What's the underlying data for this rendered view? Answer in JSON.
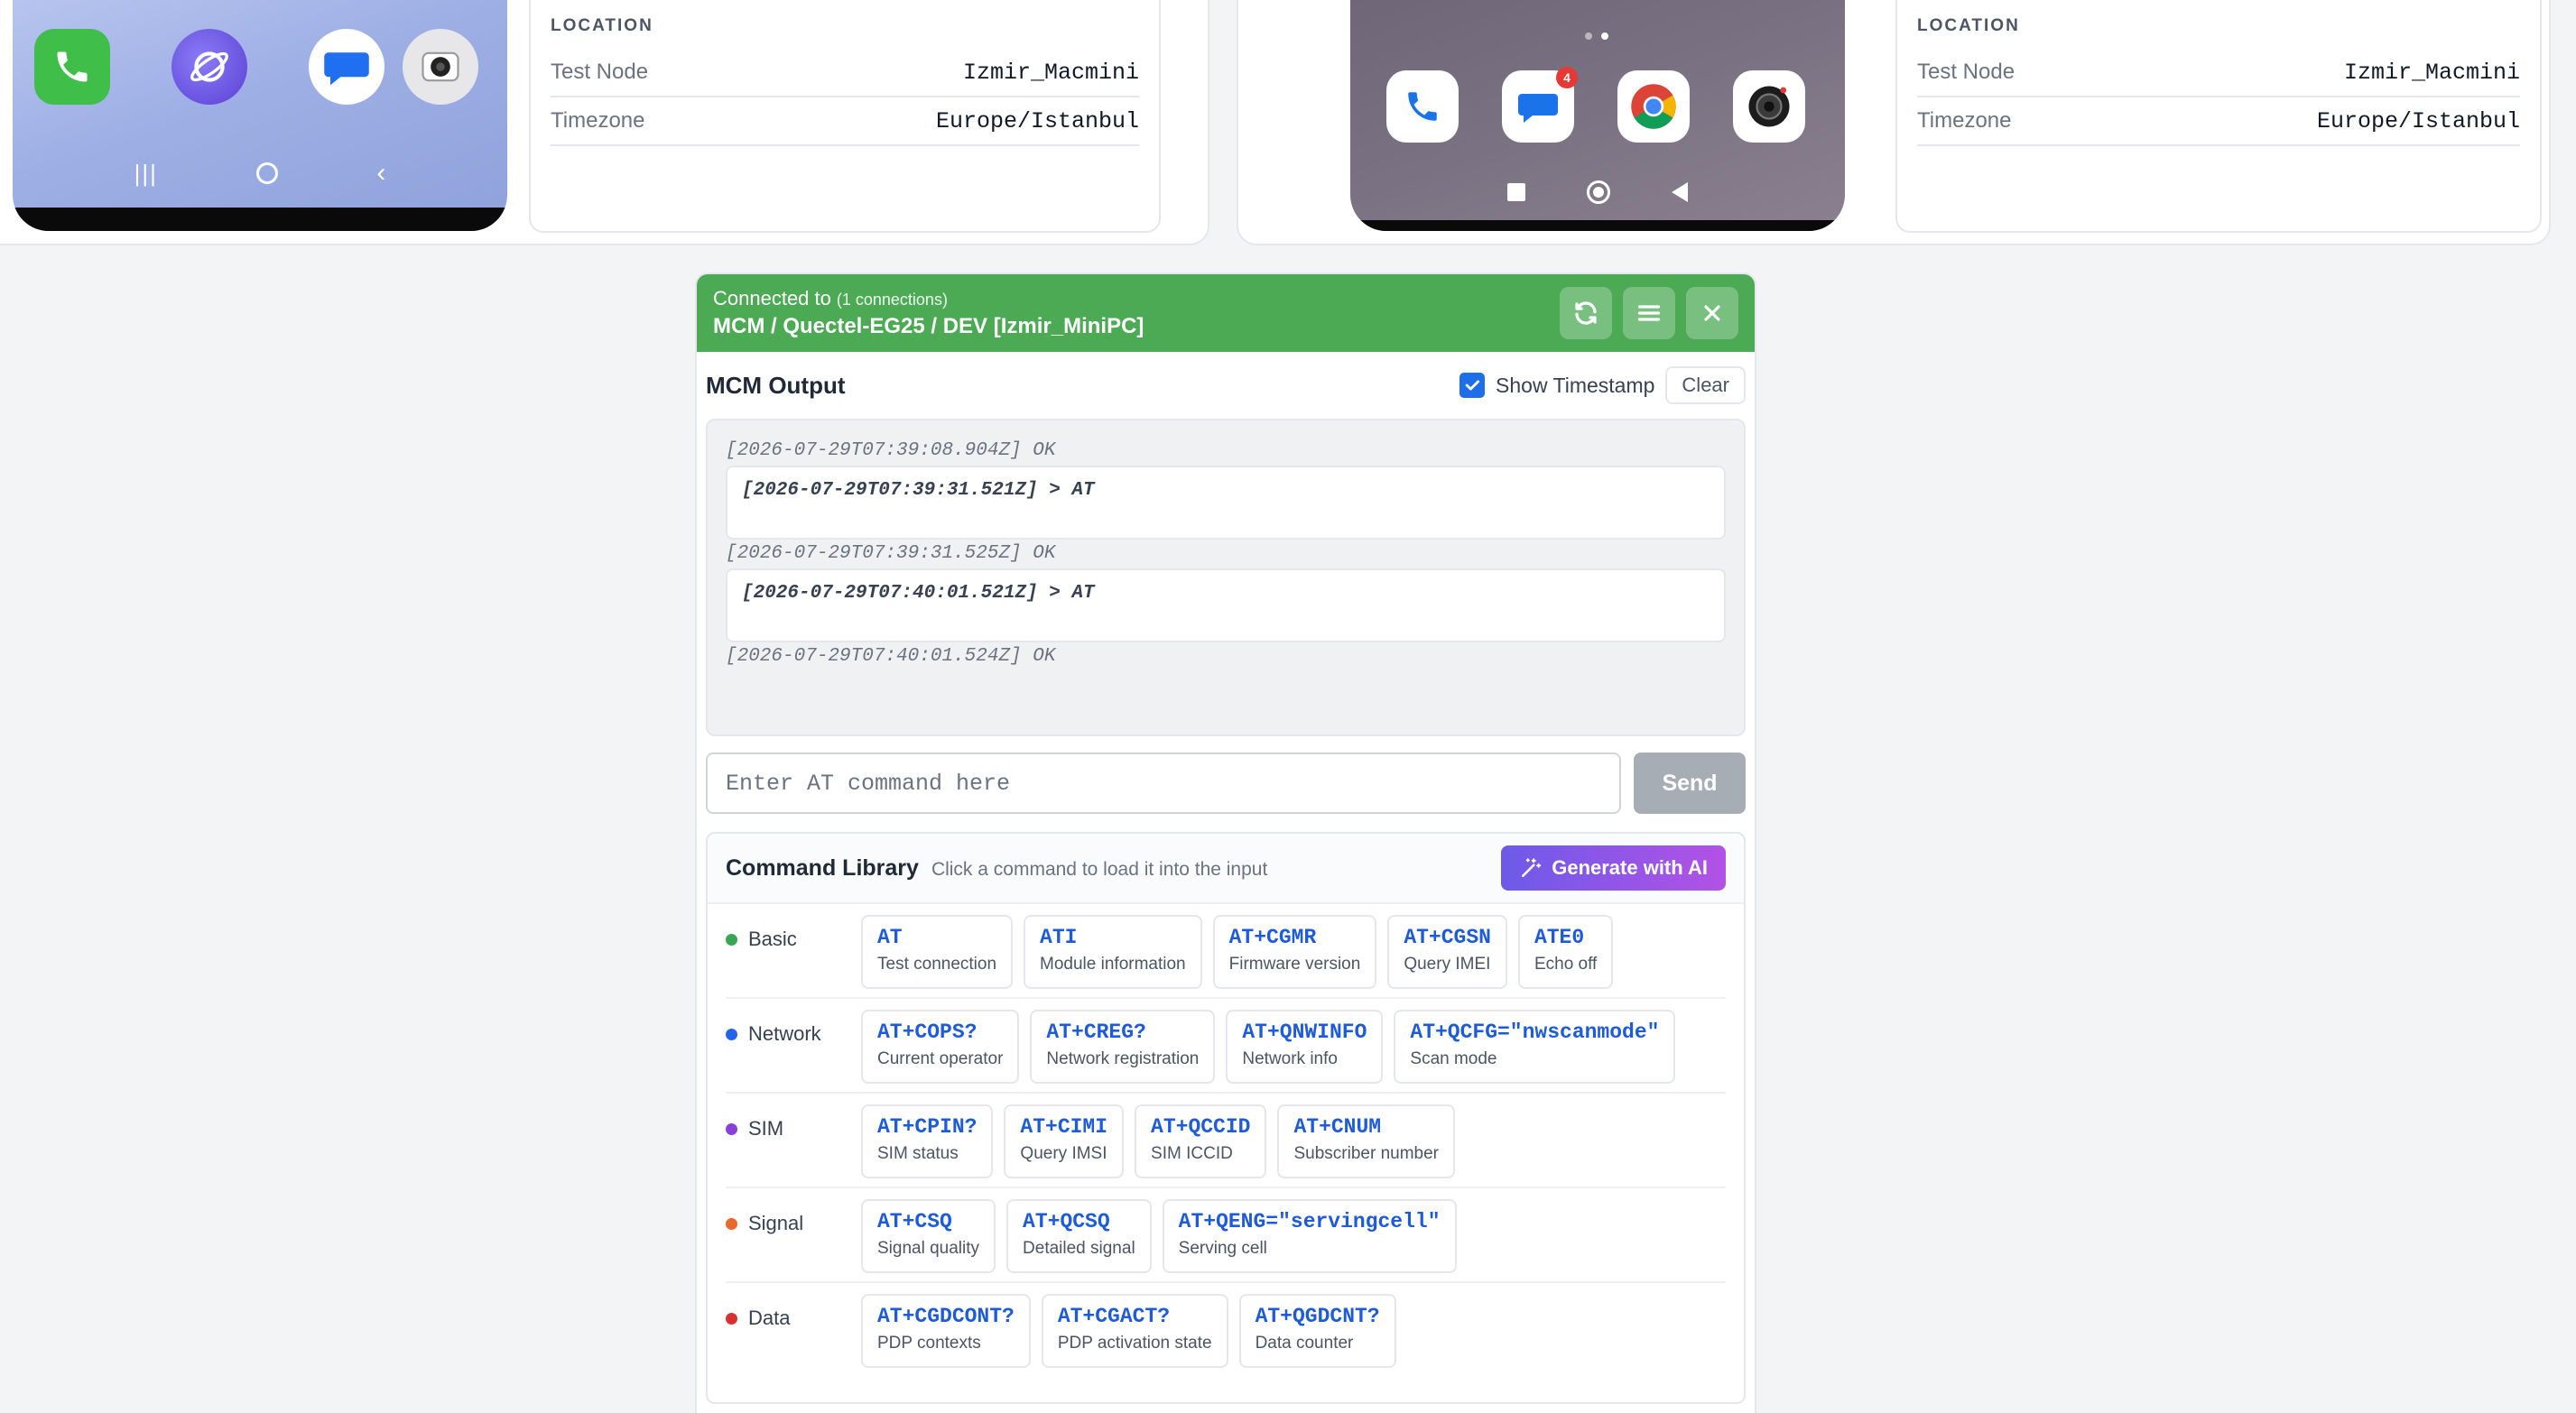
{
  "devices": [
    {
      "location_title": "LOCATION",
      "rows": [
        {
          "key": "Test Node",
          "value": "Izmir_Macmini"
        },
        {
          "key": "Timezone",
          "value": "Europe/Istanbul"
        }
      ]
    },
    {
      "location_title": "LOCATION",
      "rows": [
        {
          "key": "Test Node",
          "value": "Izmir_Macmini"
        },
        {
          "key": "Timezone",
          "value": "Europe/Istanbul"
        }
      ]
    }
  ],
  "phone2_badge": "4",
  "connection": {
    "label": "Connected to",
    "count": "(1 connections)",
    "path": "MCM / Quectel-EG25 / DEV [Izmir_MiniPC]"
  },
  "output": {
    "title": "MCM Output",
    "timestamp_label": "Show Timestamp",
    "timestamp_checked": true,
    "clear_label": "Clear",
    "lines": [
      {
        "text": "[2026-07-29T07:39:08.904Z] OK",
        "type": "response"
      },
      {
        "text": "[2026-07-29T07:39:31.521Z] > AT",
        "type": "command"
      },
      {
        "text": "[2026-07-29T07:39:31.525Z] OK",
        "type": "response"
      },
      {
        "text": "[2026-07-29T07:40:01.521Z] > AT",
        "type": "command"
      },
      {
        "text": "[2026-07-29T07:40:01.524Z] OK",
        "type": "response"
      }
    ]
  },
  "input": {
    "placeholder": "Enter AT command here",
    "value": "",
    "send_label": "Send"
  },
  "library": {
    "title": "Command Library",
    "subtitle": "Click a command to load it into the input",
    "ai_label": "Generate with AI",
    "categories": [
      {
        "name": "Basic",
        "color": "#3aa655",
        "commands": [
          {
            "cmd": "AT",
            "desc": "Test connection"
          },
          {
            "cmd": "ATI",
            "desc": "Module information"
          },
          {
            "cmd": "AT+CGMR",
            "desc": "Firmware version"
          },
          {
            "cmd": "AT+CGSN",
            "desc": "Query IMEI"
          },
          {
            "cmd": "ATE0",
            "desc": "Echo off"
          }
        ]
      },
      {
        "name": "Network",
        "color": "#2563eb",
        "commands": [
          {
            "cmd": "AT+COPS?",
            "desc": "Current operator"
          },
          {
            "cmd": "AT+CREG?",
            "desc": "Network registration"
          },
          {
            "cmd": "AT+QNWINFO",
            "desc": "Network info"
          },
          {
            "cmd": "AT+QCFG=\"nwscanmode\"",
            "desc": "Scan mode"
          }
        ]
      },
      {
        "name": "SIM",
        "color": "#8b3fd9",
        "commands": [
          {
            "cmd": "AT+CPIN?",
            "desc": "SIM status"
          },
          {
            "cmd": "AT+CIMI",
            "desc": "Query IMSI"
          },
          {
            "cmd": "AT+QCCID",
            "desc": "SIM ICCID"
          },
          {
            "cmd": "AT+CNUM",
            "desc": "Subscriber number"
          }
        ]
      },
      {
        "name": "Signal",
        "color": "#e8692a",
        "commands": [
          {
            "cmd": "AT+CSQ",
            "desc": "Signal quality"
          },
          {
            "cmd": "AT+QCSQ",
            "desc": "Detailed signal"
          },
          {
            "cmd": "AT+QENG=\"servingcell\"",
            "desc": "Serving cell"
          }
        ]
      },
      {
        "name": "Data",
        "color": "#d63031",
        "commands": [
          {
            "cmd": "AT+CGDCONT?",
            "desc": "PDP contexts"
          },
          {
            "cmd": "AT+CGACT?",
            "desc": "PDP activation state"
          },
          {
            "cmd": "AT+QGDCNT?",
            "desc": "Data counter"
          }
        ]
      }
    ]
  }
}
